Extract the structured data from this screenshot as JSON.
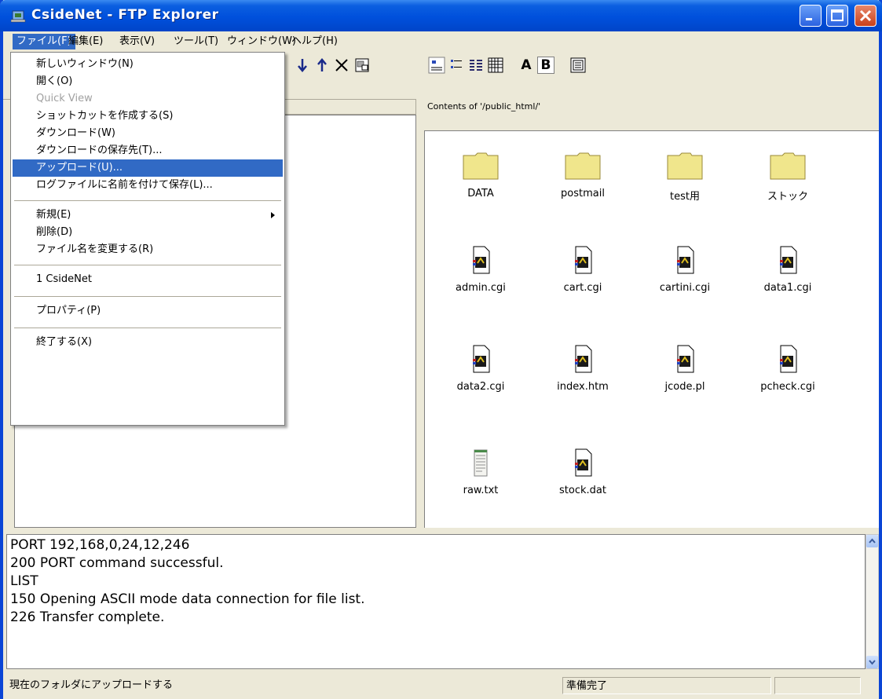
{
  "window": {
    "title": "CsideNet - FTP Explorer"
  },
  "menubar": [
    "ファイル(F)",
    "編集(E)",
    "表示(V)",
    "ツール(T)",
    "ウィンドウ(W)",
    "ヘルプ(H)"
  ],
  "file_menu": {
    "items": [
      {
        "label": "新しいウィンドウ(N)",
        "disabled": false
      },
      {
        "label": "開く(O)",
        "disabled": false
      },
      {
        "label": "Quick View",
        "disabled": true
      },
      {
        "label": "ショットカットを作成する(S)",
        "disabled": false
      },
      {
        "label": "ダウンロード(W)",
        "disabled": false
      },
      {
        "label": "ダウンロードの保存先(T)...",
        "disabled": false
      },
      {
        "label": "アップロード(U)...",
        "disabled": false,
        "highlighted": true
      },
      {
        "label": "ログファイルに名前を付けて保存(L)...",
        "disabled": false
      },
      {
        "label": "新規(E)",
        "disabled": false,
        "submenu": true
      },
      {
        "label": "削除(D)",
        "disabled": false
      },
      {
        "label": "ファイル名を変更する(R)",
        "disabled": false
      },
      {
        "label": "1 CsideNet",
        "disabled": false
      },
      {
        "label": "プロパティ(P)",
        "disabled": false
      },
      {
        "label": "終了する(X)",
        "disabled": false
      }
    ]
  },
  "right_pane": {
    "header": "Contents of '/public_html/'",
    "folders": [
      "DATA",
      "postmail",
      "test用",
      "ストック"
    ],
    "files": [
      "admin.cgi",
      "cart.cgi",
      "cartini.cgi",
      "data1.cgi",
      "data2.cgi",
      "index.htm",
      "jcode.pl",
      "pcheck.cgi",
      "raw.txt",
      "stock.dat"
    ]
  },
  "toolbar": {
    "font_a": "A",
    "font_b": "B"
  },
  "log": [
    "PORT 192,168,0,24,12,246",
    "200 PORT command successful.",
    "LIST",
    "150 Opening ASCII mode data connection for file list.",
    "226 Transfer complete."
  ],
  "status": {
    "left": "現在のフォルダにアップロードする",
    "right": "準備完了"
  }
}
